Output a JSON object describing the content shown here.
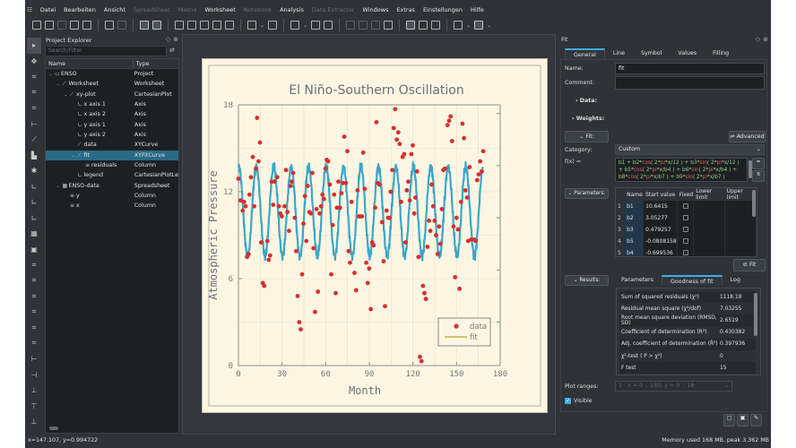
{
  "menu": [
    "Datei",
    "Bearbeiten",
    "Ansicht",
    "Spreadsheet",
    "Matrix",
    "Worksheet",
    "Notebook",
    "Analysis",
    "Data Extractor",
    "Windows",
    "Extras",
    "Einstellungen",
    "Hilfe"
  ],
  "menu_disabled": [
    "Spreadsheet",
    "Matrix",
    "Notebook",
    "Data Extractor"
  ],
  "explorer": {
    "title": "Project Explorer",
    "search_placeholder": "Search/Filter",
    "col_name": "Name",
    "col_type": "Type",
    "rows": [
      {
        "name": "ENSO",
        "type": "Project",
        "depth": 0,
        "icon": "folder-icon",
        "expanded": true
      },
      {
        "name": "Worksheet",
        "type": "Worksheet",
        "depth": 1,
        "icon": "worksheet-icon",
        "expanded": true
      },
      {
        "name": "xy-plot",
        "type": "CartesianPlot",
        "depth": 2,
        "icon": "plot-icon",
        "expanded": true
      },
      {
        "name": "x axis 1",
        "type": "Axis",
        "depth": 3,
        "icon": "axis-icon"
      },
      {
        "name": "x axis 2",
        "type": "Axis",
        "depth": 3,
        "icon": "axis-icon"
      },
      {
        "name": "y axis 1",
        "type": "Axis",
        "depth": 3,
        "icon": "axis-icon"
      },
      {
        "name": "y axis 2",
        "type": "Axis",
        "depth": 3,
        "icon": "axis-icon"
      },
      {
        "name": "data",
        "type": "XYCurve",
        "depth": 3,
        "icon": "curve-icon"
      },
      {
        "name": "fit",
        "type": "XYFitCurve",
        "depth": 3,
        "icon": "fit-curve-icon",
        "expanded": true,
        "selected": true
      },
      {
        "name": "residuals",
        "type": "Column",
        "depth": 4,
        "icon": "column-icon"
      },
      {
        "name": "legend",
        "type": "CartesianPlotLegend",
        "depth": 3,
        "icon": "legend-icon"
      },
      {
        "name": "ENSO-data",
        "type": "Spreadsheet",
        "depth": 1,
        "icon": "spreadsheet-icon",
        "expanded": true
      },
      {
        "name": "y",
        "type": "Column",
        "depth": 2,
        "icon": "column-icon"
      },
      {
        "name": "x",
        "type": "Column",
        "depth": 2,
        "icon": "column-icon"
      }
    ]
  },
  "fit": {
    "title": "Fit",
    "tabs": [
      "General",
      "Line",
      "Symbol",
      "Values",
      "Filling"
    ],
    "active_tab": "General",
    "name_label": "Name:",
    "name_value": "fit",
    "comment_label": "Comment:",
    "comment_value": "",
    "data_section": "Data:",
    "weights_section": "Weights:",
    "fit_section": "Fit:",
    "advanced_label": "Advanced",
    "category_label": "Category:",
    "category_value": "Custom",
    "fx_label": "f(x) =",
    "formula": "b1 + b2*cos( 2*pi*x/12 ) + b3*sin( 2*pi*x/12 ) + b5*cos( 2*pi*x/b4 ) + b6*sin( 2*pi*x/b4 ) + b8*cos( 2*pi*x/b7 ) + b9*sin( 2*pi*x/b7 )",
    "parameters_section": "Parameters:",
    "param_headers": [
      "Name",
      "Start value",
      "Fixed",
      "Lower limit",
      "Upper limit"
    ],
    "params": [
      {
        "n": "1",
        "name": "b1",
        "start": "10.6415"
      },
      {
        "n": "2",
        "name": "b2",
        "start": "3.05277"
      },
      {
        "n": "3",
        "name": "b3",
        "start": "0.479257"
      },
      {
        "n": "4",
        "name": "b5",
        "start": "-0.0808158"
      },
      {
        "n": "5",
        "name": "b4",
        "start": "-0.699536"
      }
    ],
    "fit_button": "Fit",
    "results_section": "Results:",
    "results_tabs": [
      "Parameters",
      "Goodness of fit",
      "Log"
    ],
    "results_active": "Goodness of fit",
    "results": [
      {
        "label": "Sum of squared residuals (χ²)",
        "value": "1118.18"
      },
      {
        "label": "Residual mean square (χ²/dof)",
        "value": "7.03255"
      },
      {
        "label": "Root mean square deviation (RMSD, SD)",
        "value": "2.6519"
      },
      {
        "label": "Coefficient of determination (R²)",
        "value": "0.430382"
      },
      {
        "label": "Adj. coefficient of determination (R̄²)",
        "value": "0.397936"
      },
      {
        "label": "χ²-test ( P > χ²)",
        "value": "0"
      },
      {
        "label": "F test",
        "value": "15"
      }
    ],
    "plot_ranges_label": "Plot ranges:",
    "plot_ranges_value": "1 : x = 0 .. 180, y = 0 .. 18",
    "visible_label": "Visible",
    "visible_checked": true
  },
  "status": {
    "coords": "x=147.107, y=0.994722",
    "memory": "Memory used 168 MB, peak 3.362 MB"
  },
  "colors": {
    "accent": "#3daee9",
    "data": "#d62f2f",
    "fit": "#3aa7c9",
    "legend_fit": "#b8a32a",
    "page": "#fdf6e3"
  },
  "chart_data": {
    "type": "scatter",
    "title": "El Niño-Southern Oscillation",
    "xlabel": "Month",
    "ylabel": "Atmospheric Pressure",
    "xlim": [
      0,
      180
    ],
    "ylim": [
      0,
      18
    ],
    "xticks": [
      "0",
      "30",
      "60",
      "90",
      "120",
      "150",
      "180"
    ],
    "yticks": [
      "0",
      "6",
      "12",
      "18"
    ],
    "grid": true,
    "legend": {
      "placement": "bottom-right",
      "entries": [
        "data",
        "fit"
      ]
    },
    "series": [
      {
        "name": "data",
        "kind": "points",
        "x": [
          0,
          1.4,
          2.9,
          3.9,
          4.9,
          5.9,
          7,
          7.6,
          8.6,
          9.9,
          10.9,
          12,
          12.8,
          13.8,
          14.8,
          15.6,
          16.7,
          17.7,
          19.9,
          20.8,
          21.8,
          22.8,
          23.9,
          24.7,
          26.7,
          27.8,
          28.8,
          29.8,
          31.7,
          32.7,
          33.7,
          34.8,
          35.8,
          36.6,
          37.6,
          38.7,
          39.7,
          40.7,
          41.8,
          42.8,
          43.8,
          44.7,
          45.7,
          46.7,
          47.7,
          48.8,
          49.8,
          50.8,
          51.6,
          52.7,
          53.7,
          54.7,
          55.8,
          56.8,
          57.8,
          58.8,
          59.9,
          60.7,
          61.7,
          62.8,
          63.8,
          64.8,
          65.8,
          66.9,
          67.7,
          68.7,
          69.8,
          70.8,
          71.8,
          72.8,
          73.9,
          74.9,
          75.7,
          76.7,
          77.8,
          79.8,
          80.9,
          81.9,
          82.9,
          83.9,
          85,
          85.8,
          86.8,
          87.9,
          88.9,
          89.9,
          91,
          92,
          93,
          94,
          94.9,
          95.9,
          96.9,
          98.8,
          99.8,
          100.8,
          101.9,
          102.9,
          103.9,
          104.7,
          105.8,
          106.8,
          107.8,
          108.9,
          109.9,
          110.9,
          111.9,
          112.9,
          114,
          114.8,
          115.8,
          116.8,
          117.8,
          118.9,
          119.9,
          120.9,
          121.7,
          122.8,
          123.8,
          124.8,
          125.9,
          126.9,
          127.9,
          128.9,
          130,
          131,
          132,
          132.9,
          133.9,
          134.9,
          135.9,
          137,
          138,
          138.9,
          139.9,
          140.9,
          142,
          143.8,
          144.9,
          145.9,
          146.9,
          147.9,
          149,
          150,
          151,
          152,
          153.1,
          154.1,
          155.1,
          156.1,
          157.2,
          158,
          159,
          160,
          162.1,
          163.1,
          164.2,
          165.2,
          166.2,
          167.3,
          168.3
        ],
        "y": [
          12.9,
          11.4,
          10.7,
          11.3,
          11,
          7.5,
          7.7,
          11.8,
          13,
          14.4,
          11,
          13.6,
          17.1,
          14.1,
          15.4,
          8.5,
          5.7,
          5.5,
          8.6,
          7.3,
          7.6,
          12.7,
          11.1,
          12.7,
          13,
          11,
          10.5,
          10.3,
          11,
          13.5,
          10.6,
          9.3,
          12.4,
          12.7,
          13.3,
          10.2,
          7.9,
          4.8,
          3,
          2.5,
          6.3,
          9.8,
          11.7,
          8.6,
          12.4,
          10.6,
          10.5,
          13.3,
          8.1,
          3.7,
          10.8,
          5.1,
          10.5,
          11,
          11.8,
          11.5,
          13.6,
          14.2,
          14.1,
          12.5,
          6.3,
          9.7,
          11.8,
          5,
          10.9,
          12.7,
          10.9,
          11.9,
          12.6,
          15.8,
          12.6,
          14.8,
          7.9,
          7.1,
          11.3,
          6.4,
          5.2,
          12.1,
          10.3,
          10.3,
          10.3,
          14.7,
          12.2,
          7.1,
          5.7,
          6.7,
          3.9,
          8.5,
          8.3,
          10.9,
          16.8,
          12.6,
          12.5,
          9.9,
          7.2,
          4.1,
          10.7,
          10.2,
          10.2,
          12,
          13.5,
          16.4,
          17.7,
          15.6,
          16.1,
          15.3,
          11.3,
          14.4,
          14.6,
          8.5,
          12.1,
          12.7,
          11.4,
          14.6,
          15.2,
          10.5,
          11.6,
          13.4,
          7.5,
          0.6,
          0.3,
          5.5,
          5,
          4.6,
          8.2,
          10,
          9.3,
          12.5,
          11,
          10,
          9,
          7.7,
          9.6,
          8.4,
          10.8,
          13.5,
          13.6,
          16.6,
          16.9,
          17.2,
          15.5,
          9.6,
          6.1,
          10.2,
          9.4,
          5.3,
          11.3,
          16.7,
          15.7,
          12.1,
          11.6,
          8.6,
          13.7,
          8.7,
          8.7,
          8.6,
          12.8,
          13.2,
          14.1,
          13.4,
          14.8
        ]
      },
      {
        "name": "fit",
        "kind": "line",
        "formula_params": {
          "b1": 10.6415,
          "b2": 3.05277,
          "b3": 0.479257,
          "period": 12
        },
        "x_range": [
          0,
          168
        ]
      }
    ]
  }
}
